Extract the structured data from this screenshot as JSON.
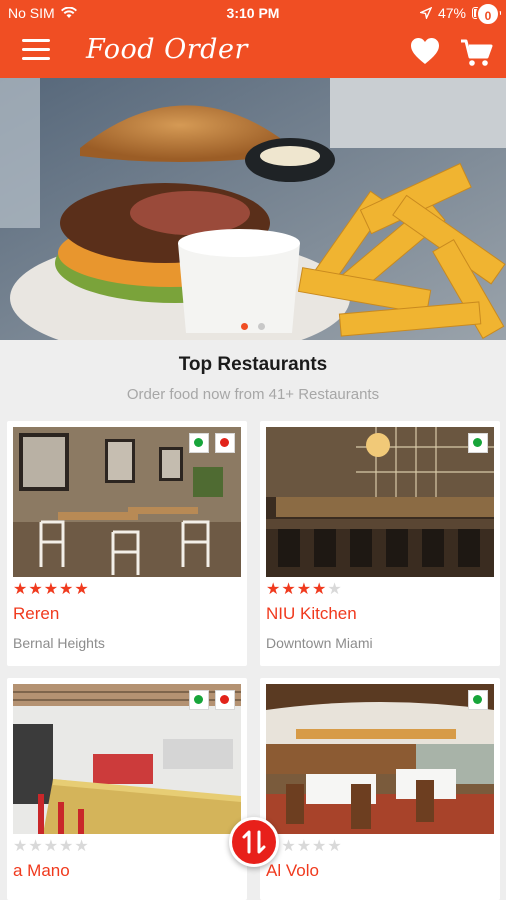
{
  "status_bar": {
    "carrier": "No SIM",
    "time": "3:10 PM",
    "battery": "47%",
    "battery_level": 0.47
  },
  "nav": {
    "title": "Food Order",
    "cart_count": "0"
  },
  "hero": {
    "slides": 2,
    "active_slide": 0
  },
  "section": {
    "title": "Top Restaurants",
    "subtitle": "Order food now from 41+ Restaurants"
  },
  "restaurants": [
    {
      "name": "Reren",
      "location": "Bernal Heights",
      "rating": 5,
      "veg": true,
      "non_veg": true
    },
    {
      "name": "NIU Kitchen",
      "location": "Downtown Miami",
      "rating": 4.5,
      "veg": true,
      "non_veg": false
    },
    {
      "name": "a Mano",
      "location": "",
      "rating": 0,
      "veg": true,
      "non_veg": true
    },
    {
      "name": "Al Volo",
      "location": "",
      "rating": 0,
      "veg": true,
      "non_veg": false
    }
  ],
  "colors": {
    "brand": "#f04e23",
    "star": "#f03a1e",
    "veg": "#17a53a",
    "non_veg": "#e2231a"
  },
  "icons": [
    "menu-icon",
    "heart-icon",
    "cart-icon",
    "sort-icon",
    "wifi-icon",
    "location-arrow-icon",
    "battery-icon"
  ]
}
